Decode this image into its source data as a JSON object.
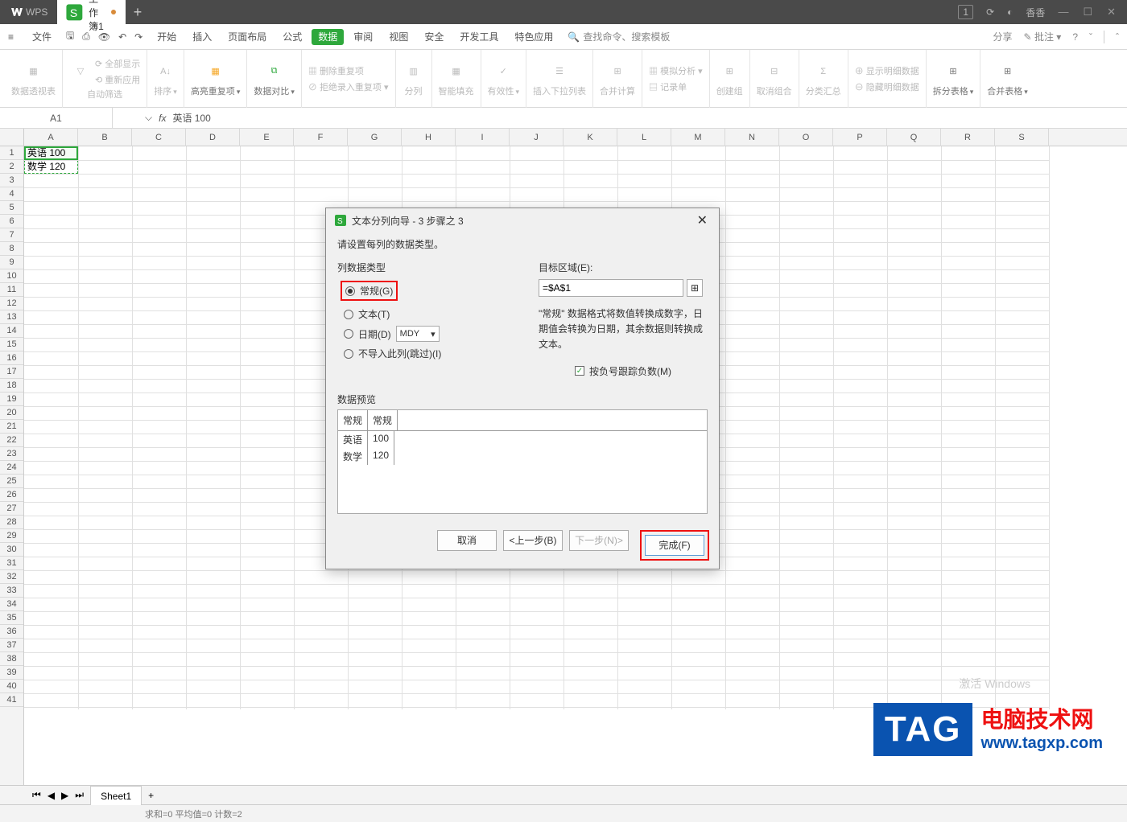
{
  "titlebar": {
    "app": "WPS",
    "tab": "工作簿1",
    "user": "香香",
    "badge": "1"
  },
  "menu": {
    "file": "文件",
    "items": [
      "开始",
      "插入",
      "页面布局",
      "公式",
      "数据",
      "审阅",
      "视图",
      "安全",
      "开发工具",
      "特色应用"
    ],
    "active_index": 4,
    "search_placeholder": "查找命令、搜索模板",
    "share": "分享",
    "comment": "批注"
  },
  "ribbon": {
    "pivot": "数据透视表",
    "autofilter": "自动筛选",
    "showAll": "全部显示",
    "reapply": "重新应用",
    "sort": "排序",
    "highlightDup": "高亮重复项",
    "dataCompare": "数据对比",
    "removeDup": "删除重复项",
    "rejectDup": "拒绝录入重复项",
    "textToCol": "分列",
    "smartFill": "智能填充",
    "validity": "有效性",
    "dropdown": "插入下拉列表",
    "consolidate": "合并计算",
    "whatif": "模拟分析",
    "form": "记录单",
    "group": "创建组",
    "ungroup": "取消组合",
    "subtotal": "分类汇总",
    "showDetail": "显示明细数据",
    "hideDetail": "隐藏明细数据",
    "splitTable": "拆分表格",
    "mergeTable": "合并表格"
  },
  "namebox": {
    "ref": "A1",
    "formula": "英语 100"
  },
  "columns": [
    "A",
    "B",
    "C",
    "D",
    "E",
    "F",
    "G",
    "H",
    "I",
    "J",
    "K",
    "L",
    "M",
    "N",
    "O",
    "P",
    "Q",
    "R",
    "S"
  ],
  "rows_count": 41,
  "cells": {
    "a1": "英语 100",
    "a2": "数学 120"
  },
  "dialog": {
    "title": "文本分列向导 - 3 步骤之 3",
    "instr": "请设置每列的数据类型。",
    "colTypeLabel": "列数据类型",
    "opt_general": "常规(G)",
    "opt_text": "文本(T)",
    "opt_date": "日期(D)",
    "date_fmt": "MDY",
    "opt_skip": "不导入此列(跳过)(I)",
    "targetLabel": "目标区域(E):",
    "target_value": "=$A$1",
    "note": "\"常规\" 数据格式将数值转换成数字，日期值会转换为日期，其余数据则转换成文本。",
    "neg_check": "按负号跟踪负数(M)",
    "previewLabel": "数据预览",
    "preview_header": [
      "常规",
      "常规"
    ],
    "preview_rows": [
      [
        "英语",
        "100"
      ],
      [
        "数学",
        "120"
      ]
    ],
    "btn_cancel": "取消",
    "btn_back": "<上一步(B)",
    "btn_next": "下一步(N)>",
    "btn_finish": "完成(F)"
  },
  "sheet": {
    "name": "Sheet1"
  },
  "status": "求和=0   平均值=0   计数=2",
  "activation": "激活 Windows",
  "tag": {
    "big": "TAG",
    "line1": "电脑技术网",
    "url": "www.tagxp.com"
  }
}
